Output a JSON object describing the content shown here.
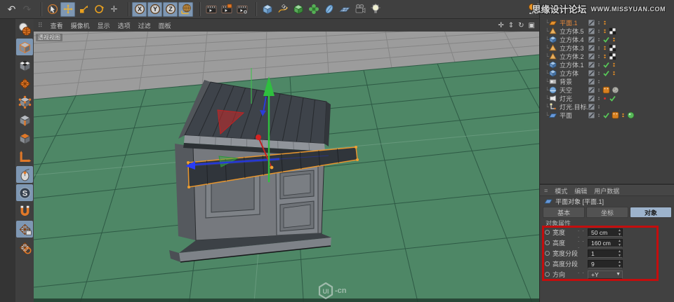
{
  "topbar": {
    "groups": [
      [
        {
          "name": "undo",
          "active": false,
          "dim": false
        },
        {
          "name": "redo",
          "active": false,
          "dim": true
        }
      ],
      [
        {
          "name": "live-selection",
          "active": false
        },
        {
          "name": "move",
          "active": true
        },
        {
          "name": "scale",
          "active": false
        },
        {
          "name": "rotate",
          "active": false
        },
        {
          "name": "last-tool",
          "active": false
        }
      ],
      [
        {
          "name": "x-axis-lock",
          "active": true
        },
        {
          "name": "y-axis-lock",
          "active": true
        },
        {
          "name": "z-axis-lock",
          "active": true
        },
        {
          "name": "coordinate-system",
          "active": true
        }
      ],
      [
        {
          "name": "render-view",
          "active": false
        },
        {
          "name": "render-picture-viewer",
          "active": false
        },
        {
          "name": "render-settings",
          "active": false
        }
      ],
      [
        {
          "name": "add-cube",
          "active": false
        },
        {
          "name": "spline-pen",
          "active": false
        },
        {
          "name": "generator",
          "active": false
        },
        {
          "name": "deformer",
          "active": false
        },
        {
          "name": "environment",
          "active": false
        },
        {
          "name": "floor",
          "active": false
        },
        {
          "name": "camera",
          "active": false
        },
        {
          "name": "light",
          "active": false
        }
      ]
    ],
    "watermark": {
      "forum": "思缘设计论坛",
      "site": "WWW.MISSYUAN.COM"
    }
  },
  "left_toolbar": {
    "items": [
      {
        "name": "make-editable",
        "active": false
      },
      {
        "name": "model-mode",
        "active": true
      },
      {
        "name": "texture-mode",
        "active": false
      },
      {
        "name": "workplane-mode",
        "active": false
      },
      {
        "name": "points-mode",
        "active": false
      },
      {
        "name": "edges-mode",
        "active": false
      },
      {
        "name": "polygons-mode",
        "active": false
      },
      {
        "name": "axis-mode",
        "active": false
      },
      {
        "name": "viewport-solo",
        "active": true
      },
      {
        "name": "enable-snap",
        "active": true
      },
      {
        "name": "magnet-snap",
        "active": false
      },
      {
        "name": "workplane-lock",
        "active": true
      },
      {
        "name": "workplane-grid",
        "active": false
      }
    ]
  },
  "viewport": {
    "menus": [
      "查看",
      "摄像机",
      "显示",
      "选项",
      "过滤",
      "面板"
    ],
    "view_label": "透视视图",
    "controls": [
      {
        "name": "pan-view",
        "glyph": "✛"
      },
      {
        "name": "zoom-view",
        "glyph": "⇕"
      },
      {
        "name": "rotate-view",
        "glyph": "↻"
      },
      {
        "name": "toggle-layout",
        "glyph": "▣"
      }
    ],
    "logo": {
      "text": "UI",
      "suffix": "-cn"
    }
  },
  "object_manager": {
    "rows": [
      {
        "label": "平面.1",
        "icon": "plane-orange",
        "selected": true,
        "tags": [
          "vdots-orange"
        ]
      },
      {
        "label": "立方体.5",
        "icon": "cone",
        "selected": false,
        "tags": [
          "vdots-orange",
          "xtex"
        ]
      },
      {
        "label": "立方体.4",
        "icon": "cube",
        "selected": false,
        "tags": [
          "check",
          "vdots-orange"
        ]
      },
      {
        "label": "立方体.3",
        "icon": "cone",
        "selected": false,
        "tags": [
          "vdots-orange",
          "xtex"
        ]
      },
      {
        "label": "立方体.2",
        "icon": "cone",
        "selected": false,
        "tags": [
          "vdots-orange",
          "xtex"
        ]
      },
      {
        "label": "立方体.1",
        "icon": "cube",
        "selected": false,
        "tags": [
          "check",
          "vdots-orange"
        ]
      },
      {
        "label": "立方体",
        "icon": "cube",
        "selected": false,
        "tags": [
          "check",
          "vdots-orange"
        ]
      },
      {
        "label": "背景",
        "icon": "background",
        "selected": false,
        "tags": []
      },
      {
        "label": "天空",
        "icon": "sky",
        "selected": false,
        "tags": [
          "comp",
          "noise"
        ]
      },
      {
        "label": "灯光",
        "icon": "light-obj",
        "selected": false,
        "tags": [
          "reddot",
          "check",
          "target"
        ]
      },
      {
        "label": "灯光.目标.1",
        "icon": "target-light",
        "selected": false,
        "tags": []
      },
      {
        "label": "平面",
        "icon": "plane-blue",
        "selected": false,
        "tags": [
          "check",
          "comp",
          "vdots-orange",
          "greenball"
        ]
      }
    ]
  },
  "attributes": {
    "menu": [
      "模式",
      "编辑",
      "用户数据"
    ],
    "title": "平面对象 [平面.1]",
    "tabs": [
      {
        "label": "基本",
        "active": false
      },
      {
        "label": "坐标",
        "active": false
      },
      {
        "label": "对象",
        "active": true
      }
    ],
    "section": "对象属性",
    "fields": [
      {
        "label": "宽度",
        "leader": ". . .",
        "value": "50 cm",
        "control": "spinner"
      },
      {
        "label": "高度",
        "leader": ". . .",
        "value": "160 cm",
        "control": "spinner"
      },
      {
        "label": "宽度分段",
        "leader": "",
        "value": "1",
        "control": "spinner"
      },
      {
        "label": "高度分段",
        "leader": "",
        "value": "9",
        "control": "spinner"
      },
      {
        "label": "方向",
        "leader": ". . .",
        "value": "+Y",
        "control": "dropdown"
      }
    ]
  },
  "colors": {
    "ground_green": "#4e8766",
    "grid_green": "#2e5a45",
    "sky_gray": "#9c9c9c",
    "selection_orange": "#e8962e",
    "highlight_blue": "#7e97b3",
    "annotation_red": "#c40d0d"
  }
}
